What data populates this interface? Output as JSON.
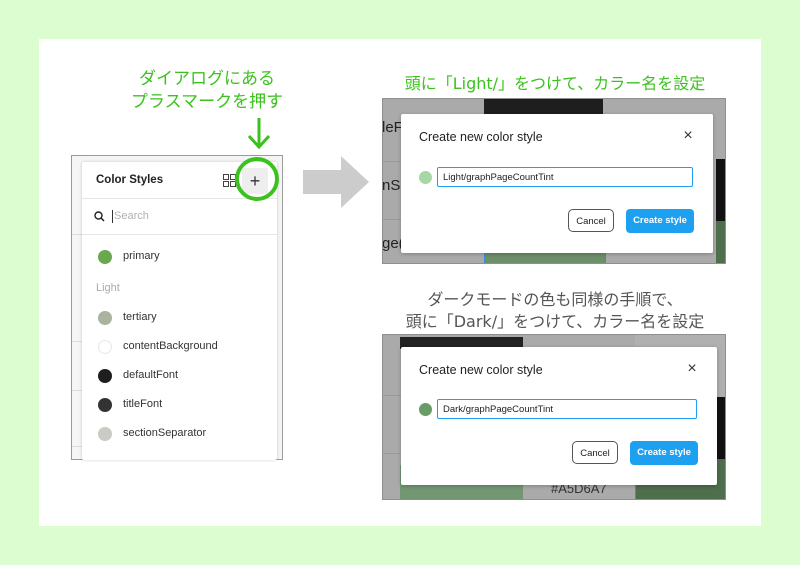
{
  "captions": {
    "left_line1": "ダイアログにある",
    "left_line2": "プラスマークを押す",
    "right_top": "頭に「Light/」をつけて、カラー名を設定",
    "right_bottom_line1": "ダークモードの色も同様の手順で、",
    "right_bottom_line2": "頭に「Dark/」をつけて、カラー名を設定"
  },
  "colors": {
    "background": "#dcfdd0",
    "annotation_green": "#3cc21e",
    "primary_button": "#1ea0f0"
  },
  "color_styles_panel": {
    "title": "Color Styles",
    "grid_icon": "grid-view-icon",
    "add_button": "+",
    "search_placeholder": "Search",
    "search_value": "",
    "ungrouped": [
      {
        "name": "primary",
        "color": "#6aa84f"
      }
    ],
    "group_label": "Light",
    "light_styles": [
      {
        "name": "tertiary",
        "color": "#a9b3a0"
      },
      {
        "name": "contentBackground",
        "color": "#ffffff"
      },
      {
        "name": "defaultFont",
        "color": "#1e1e1e"
      },
      {
        "name": "titleFont",
        "color": "#333333"
      },
      {
        "name": "sectionSeparator",
        "color": "#c8ccc4"
      }
    ]
  },
  "dialog_light": {
    "title": "Create new color style",
    "close_icon": "×",
    "swatch_color": "#a7d7a5",
    "name_value": "Light/graphPageCountTint",
    "cancel_label": "Cancel",
    "create_label": "Create style",
    "bg_fragments": [
      "leF",
      "nSe",
      "ge("
    ]
  },
  "dialog_dark": {
    "title": "Create new color style",
    "close_icon": "×",
    "swatch_color": "#679c66",
    "name_value": "Dark/graphPageCountTint",
    "cancel_label": "Cancel",
    "create_label": "Create style",
    "bg_fragments": [
      "#A5D6A7"
    ]
  }
}
